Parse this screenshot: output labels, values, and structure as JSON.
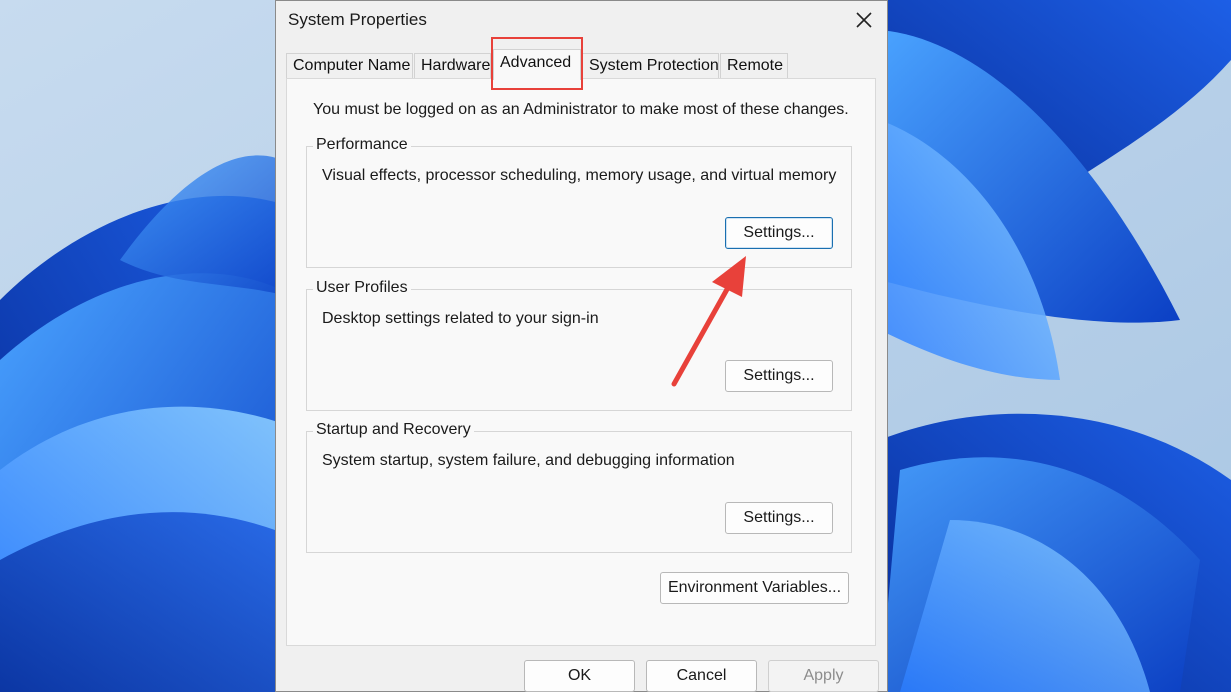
{
  "window": {
    "title": "System Properties",
    "close_glyph": "✕"
  },
  "tabs": [
    {
      "label": "Computer Name",
      "active": false
    },
    {
      "label": "Hardware",
      "active": false
    },
    {
      "label": "Advanced",
      "active": true
    },
    {
      "label": "System Protection",
      "active": false
    },
    {
      "label": "Remote",
      "active": false
    }
  ],
  "advanced": {
    "admin_note": "You must be logged on as an Administrator to make most of these changes.",
    "performance": {
      "label": "Performance",
      "description": "Visual effects, processor scheduling, memory usage, and virtual memory",
      "button": "Settings..."
    },
    "user_profiles": {
      "label": "User Profiles",
      "description": "Desktop settings related to your sign-in",
      "button": "Settings..."
    },
    "startup_recovery": {
      "label": "Startup and Recovery",
      "description": "System startup, system failure, and debugging information",
      "button": "Settings..."
    },
    "environment_button": "Environment Variables..."
  },
  "footer": {
    "ok": "OK",
    "cancel": "Cancel",
    "apply": "Apply"
  },
  "colors": {
    "annotation": "#e8413a",
    "focus_border": "#1a6fb0"
  }
}
